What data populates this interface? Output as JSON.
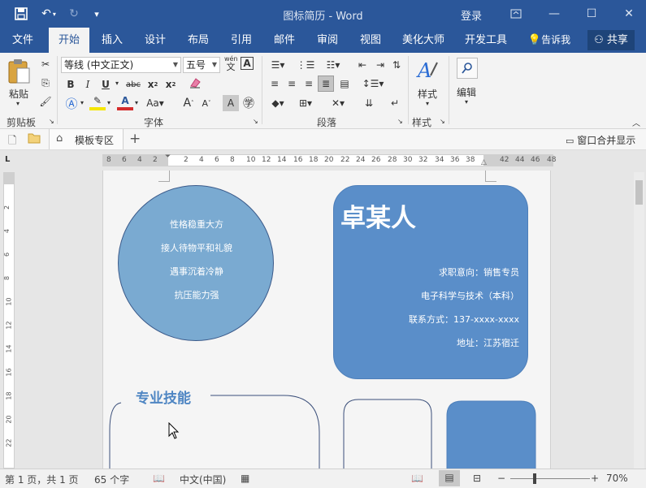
{
  "window": {
    "doc_title": "图标简历 - Word",
    "login": "登录"
  },
  "tabs": [
    "文件",
    "开始",
    "插入",
    "设计",
    "布局",
    "引用",
    "邮件",
    "审阅",
    "视图",
    "美化大师",
    "开发工具"
  ],
  "tellme": "告诉我",
  "share": "共享",
  "ribbon": {
    "paste": "粘贴",
    "clipboard": "剪贴板",
    "font_name": "等线 (中文正文)",
    "font_size": "五号",
    "font_group": "字体",
    "paragraph_group": "段落",
    "styles": "样式",
    "styles_group": "样式",
    "edit": "编辑",
    "wen": "wén",
    "wen_char": "文"
  },
  "docbar": {
    "template_tab": "模板专区",
    "merge": "窗口合并显示"
  },
  "ruler": {
    "h_numbers": [
      "8",
      "6",
      "4",
      "2",
      "2",
      "4",
      "6",
      "8",
      "10",
      "12",
      "14",
      "16",
      "18",
      "20",
      "22",
      "24",
      "26",
      "28",
      "30",
      "32",
      "34",
      "36",
      "38",
      "42",
      "44",
      "46",
      "48"
    ],
    "v_numbers": [
      "2",
      "4",
      "6",
      "8",
      "10",
      "12",
      "14",
      "16",
      "18",
      "20",
      "22"
    ]
  },
  "resume": {
    "traits": [
      "性格稳重大方",
      "接人待物平和礼貌",
      "遇事沉着冷静",
      "抗压能力强"
    ],
    "name": "卓某人",
    "info": [
      "求职意向：销售专员",
      "电子科学与技术（本科）",
      "联系方式：137-xxxx-xxxx",
      "地址：江苏宿迁"
    ],
    "skills_title": "专业技能"
  },
  "status": {
    "page": "第 1 页，共 1 页",
    "words": "65 个字",
    "lang": "中文(中国)",
    "zoom": "70%"
  },
  "colors": {
    "titlebar": "#2b579a",
    "circle": "#7aaad1",
    "namebox": "#5a8ec9",
    "accent": "#4f86c3"
  }
}
